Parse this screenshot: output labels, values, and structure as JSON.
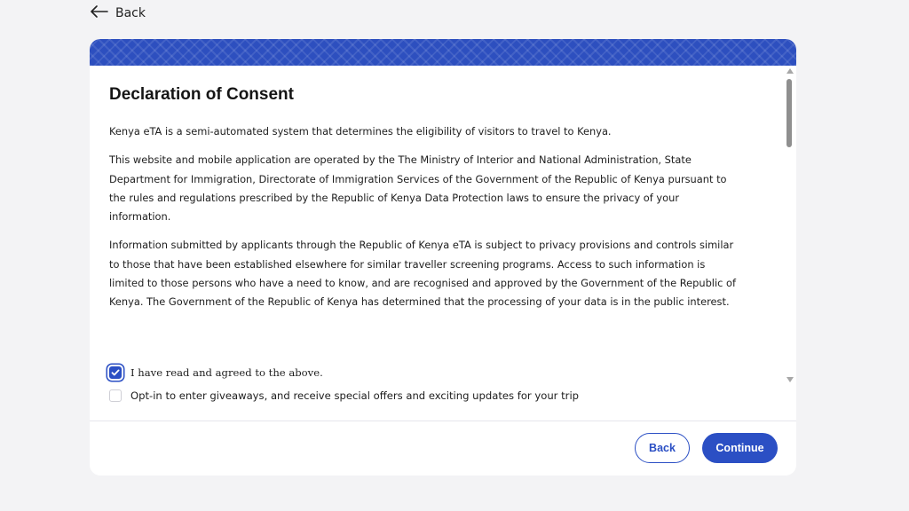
{
  "nav": {
    "back_label": "Back"
  },
  "consent": {
    "title": "Declaration of Consent",
    "paragraphs": [
      "Kenya eTA is a semi-automated system that determines the eligibility of visitors to travel to Kenya.",
      "This website and mobile application are operated by the The Ministry of Interior and National Administration, State Department for Immigration, Directorate of Immigration Services of the Government of the Republic of Kenya pursuant to the rules and regulations prescribed by the Republic of Kenya Data Protection laws to ensure the privacy of your information.",
      "Information submitted by applicants through the Republic of Kenya eTA is subject to privacy provisions and controls similar to those that have been established elsewhere for similar traveller screening programs. Access to such information is limited to those persons who have a need to know, and are recognised and approved by the Government of the Republic of Kenya. The Government of the Republic of Kenya has determined that the processing of your data is in the public interest."
    ]
  },
  "checkboxes": {
    "agree": {
      "label": "I have read and agreed to the above.",
      "checked": true
    },
    "optin": {
      "label": "Opt-in to enter giveaways, and receive special offers and exciting updates for your trip",
      "checked": false
    }
  },
  "footer": {
    "back_label": "Back",
    "continue_label": "Continue"
  },
  "colors": {
    "brand": "#2b4fc4",
    "banner": "#2d4fbf"
  }
}
